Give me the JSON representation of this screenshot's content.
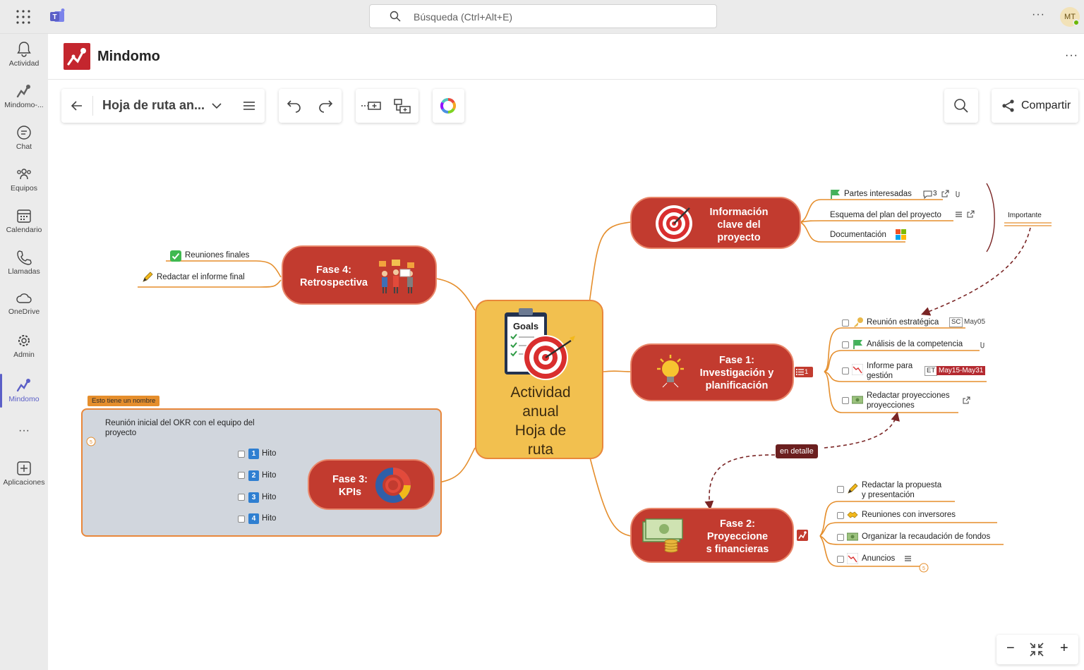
{
  "topbar": {
    "search_placeholder": "Búsqueda (Ctrl+Alt+E)",
    "more": "···",
    "avatar_initials": "MT"
  },
  "rail": {
    "items": [
      {
        "label": "Actividad",
        "icon": "bell-icon"
      },
      {
        "label": "Mindomo-...",
        "icon": "mindomo-icon"
      },
      {
        "label": "Chat",
        "icon": "chat-icon"
      },
      {
        "label": "Equipos",
        "icon": "teams-icon"
      },
      {
        "label": "Calendario",
        "icon": "calendar-icon"
      },
      {
        "label": "Llamadas",
        "icon": "phone-icon"
      },
      {
        "label": "OneDrive",
        "icon": "cloud-icon"
      },
      {
        "label": "Admin",
        "icon": "admin-icon"
      },
      {
        "label": "Mindomo",
        "icon": "mindomo-icon",
        "active": true
      },
      {
        "label": "···",
        "icon": "more-icon"
      },
      {
        "label": "Aplicaciones",
        "icon": "add-app-icon"
      }
    ]
  },
  "app": {
    "name": "Mindomo",
    "more": "···"
  },
  "toolbar": {
    "map_title": "Hoja de ruta an...",
    "share_label": "Compartir"
  },
  "colors": {
    "node_red": "#c23b2f",
    "node_border": "#e9876a",
    "central_fill": "#f2c04f",
    "connector": "#e58e2c",
    "accent_teams": "#5b5fc7"
  },
  "map": {
    "central": {
      "goals_label": "Goals",
      "label_lines": [
        "Actividad",
        "anual",
        "Hoja de",
        "ruta"
      ]
    },
    "info": {
      "lines": [
        "Información",
        "clave del",
        "proyecto"
      ],
      "leaves": [
        {
          "label": "Partes interesadas",
          "comment_count": "3"
        },
        {
          "label": "Esquema del plan del proyecto"
        },
        {
          "label": "Documentación"
        }
      ],
      "callout": "Importante"
    },
    "fase1": {
      "lines": [
        "Fase 1:",
        "Investigación y",
        "planificación"
      ],
      "badge": "1",
      "leaves": [
        {
          "label": "Reunión estratégica",
          "tag": "SC",
          "date": "May05"
        },
        {
          "label": "Análisis de la competencia"
        },
        {
          "label_lines": [
            "Informe para",
            "gestión"
          ],
          "tag": "ET",
          "date": "May15-May31"
        },
        {
          "label_lines": [
            "Redactar proyecciones",
            "proyecciones"
          ]
        }
      ]
    },
    "fase2": {
      "lines": [
        "Fase 2:",
        "Proyeccione",
        "s financieras"
      ],
      "leaves": [
        {
          "label_lines": [
            "Redactar la propuesta",
            "y presentación"
          ]
        },
        {
          "label": "Reuniones con inversores"
        },
        {
          "label": "Organizar la recaudación de fondos"
        },
        {
          "label": "Anuncios"
        }
      ],
      "relation_label": "en detalle"
    },
    "fase3": {
      "lines": [
        "Fase 3:",
        "KPIs"
      ],
      "group_label": "Esto tiene un nombre",
      "group_topic_lines": [
        "Reunión inicial del OKR con el equipo del",
        "proyecto"
      ],
      "hitos": [
        {
          "num": "1",
          "label": "Hito"
        },
        {
          "num": "2",
          "label": "Hito"
        },
        {
          "num": "3",
          "label": "Hito"
        },
        {
          "num": "4",
          "label": "Hito"
        }
      ]
    },
    "fase4": {
      "lines": [
        "Fase 4:",
        "Retrospectiva"
      ],
      "leaves": [
        {
          "label": "Reuniones finales"
        },
        {
          "label": "Redactar el informe final"
        }
      ]
    }
  },
  "zoom": {
    "minus": "−",
    "plus": "+"
  }
}
